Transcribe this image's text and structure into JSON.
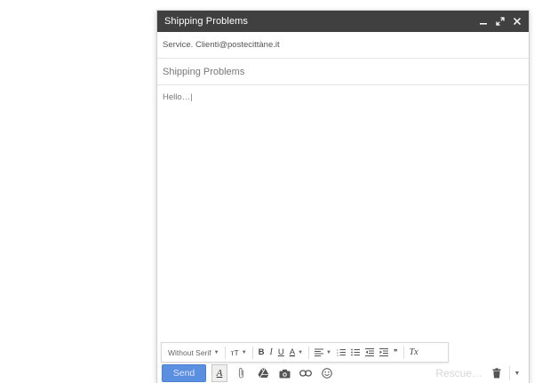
{
  "window": {
    "title": "Shipping Problems",
    "controls": [
      "minimize-icon",
      "expand-icon",
      "close-icon"
    ]
  },
  "to": {
    "value": "Service. Clienti@postecittàne.it"
  },
  "subject": {
    "value": "Shipping Problems"
  },
  "body": {
    "text": "Hello…|"
  },
  "format_bar": {
    "font": "Without Serif",
    "size_label": "тT",
    "bold": "B",
    "italic": "I",
    "underline": "U",
    "text_color": "A",
    "quote": "❞",
    "remove_format": "Tx"
  },
  "bottom": {
    "send_label": "Send",
    "format_toggle": "A",
    "rescue_label": "Rescue…",
    "icons": [
      "attach-icon",
      "drive-icon",
      "camera-icon",
      "link-icon",
      "emoji-icon",
      "trash-icon",
      "more-options-icon"
    ]
  },
  "colors": {
    "titlebar": "#404040",
    "send": "#5b8fe0"
  }
}
